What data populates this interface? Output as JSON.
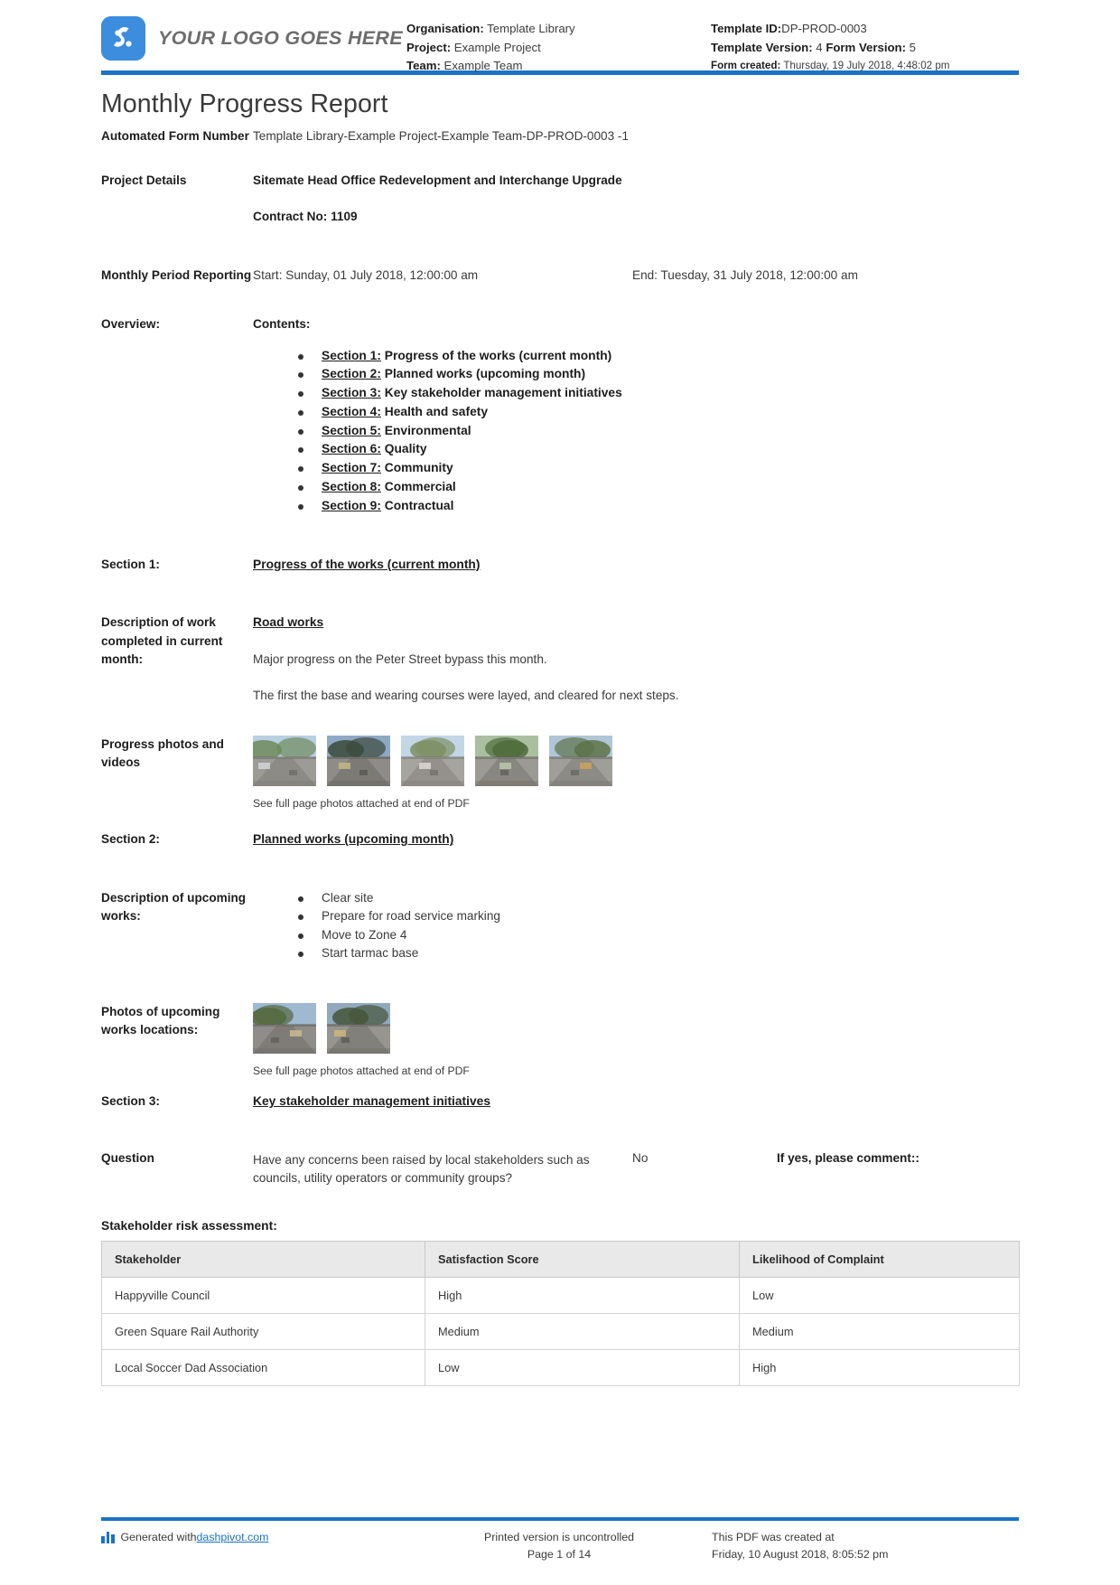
{
  "header": {
    "logo_text": "YOUR LOGO GOES HERE",
    "organisation_label": "Organisation:",
    "organisation_value": "Template Library",
    "project_label": "Project:",
    "project_value": "Example Project",
    "team_label": "Team:",
    "team_value": "Example Team",
    "template_id_label": "Template ID:",
    "template_id_value": "DP-PROD-0003",
    "template_version_label": "Template Version:",
    "template_version_value": "4",
    "form_version_label": "Form Version:",
    "form_version_value": "5",
    "form_created_label": "Form created:",
    "form_created_value": "Thursday, 19 July 2018, 4:48:02 pm"
  },
  "title": "Monthly Progress Report",
  "fields": {
    "automated_form_number_label": "Automated Form Number",
    "automated_form_number_value": "Template Library-Example Project-Example Team-DP-PROD-0003   -1",
    "project_details_label": "Project Details",
    "project_details_value": "Sitemate Head Office Redevelopment and Interchange Upgrade",
    "contract_no": "Contract No: 1109",
    "monthly_period_label": "Monthly Period Reporting",
    "period_start": "Start: Sunday, 01 July 2018, 12:00:00 am",
    "period_end": "End: Tuesday, 31 July 2018, 12:00:00 am",
    "overview_label": "Overview:",
    "contents_label": "Contents:"
  },
  "contents": [
    {
      "num": "Section 1:",
      "text": "Progress of the works (current month)"
    },
    {
      "num": "Section 2:",
      "text": "Planned works (upcoming month)"
    },
    {
      "num": "Section 3:",
      "text": "Key stakeholder management initiatives"
    },
    {
      "num": "Section 4:",
      "text": "Health and safety"
    },
    {
      "num": "Section 5:",
      "text": "Environmental"
    },
    {
      "num": "Section 6:",
      "text": "Quality"
    },
    {
      "num": "Section 7:",
      "text": "Community"
    },
    {
      "num": "Section 8:",
      "text": "Commercial"
    },
    {
      "num": "Section 9:",
      "text": "Contractual"
    }
  ],
  "section1": {
    "label": "Section 1:",
    "heading": "Progress of the works (current month)",
    "desc_label": "Description of work completed in current month:",
    "desc_heading": "Road works",
    "para1": "Major progress on the Peter Street bypass this month.",
    "para2": "The first the base and wearing courses were layed, and cleared for next steps.",
    "photos_label": "Progress photos and videos",
    "photos_caption": "See full page photos attached at end of PDF",
    "photo_count": 5
  },
  "section2": {
    "label": "Section 2:",
    "heading": "Planned works (upcoming month)",
    "desc_label": "Description of upcoming works:",
    "items": [
      "Clear site",
      "Prepare for road service marking",
      "Move to Zone 4",
      "Start tarmac base"
    ],
    "photos_label": "Photos of upcoming works locations:",
    "photos_caption": "See full page photos attached at end of PDF",
    "photo_count": 2
  },
  "section3": {
    "label": "Section 3:",
    "heading": "Key stakeholder management initiatives",
    "question_label": "Question",
    "question_text": "Have any concerns been raised by local stakeholders such as councils, utility operators or community groups?",
    "answer": "No",
    "comment_label": "If yes, please comment::",
    "table_title": "Stakeholder risk assessment:",
    "table": {
      "columns": [
        "Stakeholder",
        "Satisfaction Score",
        "Likelihood of Complaint"
      ],
      "rows": [
        [
          "Happyville Council",
          "High",
          "Low"
        ],
        [
          "Green Square Rail Authority",
          "Medium",
          "Medium"
        ],
        [
          "Local Soccer Dad Association",
          "Low",
          "High"
        ]
      ]
    }
  },
  "footer": {
    "generated_prefix": "Generated with ",
    "generated_link": "dashpivot.com",
    "printed_line1": "Printed version is uncontrolled",
    "printed_line2": "Page 1 of 14",
    "created_line1": "This PDF was created at",
    "created_line2": "Friday, 10 August 2018, 8:05:52 pm"
  },
  "colors": {
    "brand_blue": "#1b72c6",
    "logo_blue": "#3c8dde",
    "table_header_bg": "#e9e9e9"
  }
}
